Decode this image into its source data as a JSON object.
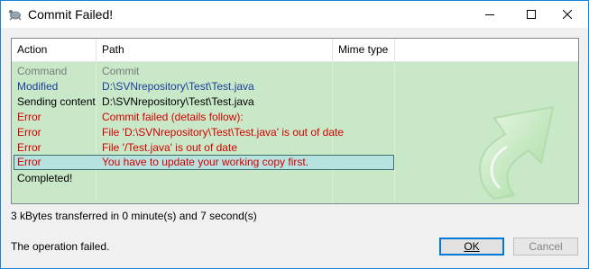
{
  "window": {
    "title": "Commit Failed!"
  },
  "columns": [
    "Action",
    "Path",
    "Mime type"
  ],
  "rows": [
    {
      "action": "Command",
      "path": "Commit",
      "color": "#7a7a7a"
    },
    {
      "action": "Modified",
      "path": "D:\\SVNrepository\\Test\\Test.java",
      "color": "#1a3f9c"
    },
    {
      "action": "Sending content",
      "path": "D:\\SVNrepository\\Test\\Test.java",
      "color": "#000000"
    },
    {
      "action": "Error",
      "path": "Commit failed (details follow):",
      "color": "#d40000"
    },
    {
      "action": "Error",
      "path": "File 'D:\\SVNrepository\\Test\\Test.java' is out of date",
      "color": "#d40000"
    },
    {
      "action": "Error",
      "path": "File '/Test.java' is out of date",
      "color": "#d40000"
    },
    {
      "action": "Error",
      "path": "You have to update your working copy first.",
      "color": "#d40000",
      "selected": true
    },
    {
      "action": "Completed!",
      "path": "",
      "color": "#000000"
    }
  ],
  "transfer_text": "3 kBytes transferred in 0 minute(s) and 7 second(s)",
  "status_text": "The operation failed.",
  "buttons": {
    "ok": "OK",
    "cancel": "Cancel"
  },
  "colors": {
    "list_background": "#c8e8c8",
    "error": "#d40000",
    "selection": "#b6e3e0"
  },
  "icons": {
    "app": "tortoise-icon",
    "decoration": "green-curved-arrow-icon"
  }
}
